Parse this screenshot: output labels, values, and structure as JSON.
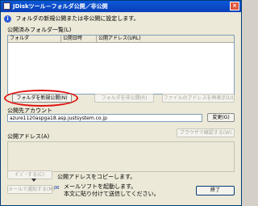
{
  "window": {
    "title": "JDiskツール－フォルダ公開／非公開",
    "close_glyph": "×"
  },
  "info": {
    "icon_glyph": "i",
    "message": "フォルダの新規公開または非公開に設定します。"
  },
  "published_list": {
    "group_label": "公開済みフォルダ一覧(L)",
    "columns": [
      "フォルダ",
      "公開日時",
      "公開アドレス(URL)"
    ]
  },
  "buttons": {
    "new_publish": "フォルダを新規公開(N)",
    "unpublish": "フォルダを非公開(R)",
    "change_address": "ファイルのアドレスを再表示(U)",
    "change": "変更(G)",
    "open_browser": "ブラウザで確認する(W)",
    "copy": "ﾎﾟﾋﾟｰする(C)",
    "send_mail": "メールで通知する(M)",
    "close": "終了"
  },
  "account": {
    "label": "公開先アカウント",
    "value": "azure1120aspga18.asp.justsystem.co.jp"
  },
  "url_section": {
    "label": "公開アドレス(A)"
  },
  "hints": {
    "copy_hint": "公開アドレスをコピーします。",
    "mail_hint_1": "メールソフトを起動します。",
    "mail_hint_2": "本文に貼り付けて送信してください。"
  },
  "colors": {
    "highlight": "#e01010",
    "title_bar": "#0a4fc8"
  }
}
